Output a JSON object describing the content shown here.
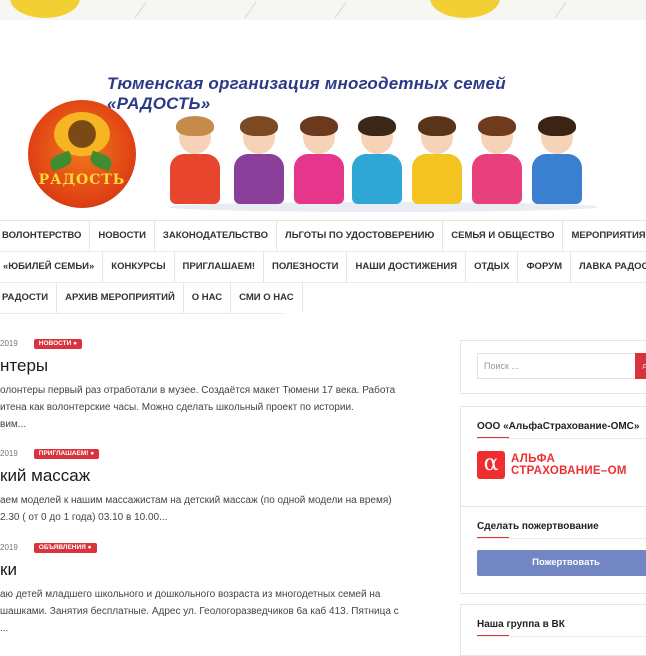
{
  "site": {
    "title": "Тюменская организация многодетных семей «РАДОСТЬ»",
    "logo_text": "РАДОСТЬ"
  },
  "nav": {
    "rows": [
      [
        "ВОЛОНТЕРСТВО",
        "НОВОСТИ",
        "ЗАКОНОДАТЕЛЬСТВО",
        "ЛЬГОТЫ ПО УДОСТОВЕРЕНИЮ",
        "СЕМЬЯ И ОБЩЕСТВО",
        "МЕРОПРИЯТИЯ"
      ],
      [
        "«ЮБИЛЕЙ СЕМЬИ»",
        "КОНКУРСЫ",
        "ПРИГЛАШАЕМ!",
        "ПОЛЕЗНОСТИ",
        "НАШИ ДОСТИЖЕНИЯ",
        "ОТДЫХ",
        "ФОРУМ",
        "ЛАВКА РАДОСТИ"
      ],
      [
        "РАДОСТИ",
        "АРХИВ МЕРОПРИЯТИЙ",
        "О НАС",
        "СМИ О НАС"
      ]
    ]
  },
  "posts": [
    {
      "date": "2019",
      "category": "НОВОСТИ",
      "title": "нтеры",
      "excerpt": [
        "олонтеры первый раз отработали в музее. Создаётся макет Тюмени 17 века. Работа",
        "итена как волонтерские часы. Можно сделать школьный проект по истории.",
        "вим..."
      ]
    },
    {
      "date": "2019",
      "category": "ПРИГЛАШАЕМ!",
      "title": "кий массаж",
      "excerpt": [
        "аем моделей к нашим массажистам на детский массаж (по одной модели на время)",
        "2.30 ( от 0 до 1 года) 03.10 в 10.00..."
      ]
    },
    {
      "date": "2019",
      "category": "ОБЪЯВЛЕНИЯ",
      "title": "ки",
      "excerpt": [
        "аю детей младшего школьного и дошкольного возраста из многодетных семей на",
        "шашками. Занятия бесплатные. Адрес ул. Геологоразведчиков 6а каб 413. Пятница с",
        "..."
      ]
    }
  ],
  "sidebar": {
    "search_placeholder": "Поиск ...",
    "sponsor_title": "ООО «АльфаСтрахование-ОМС»",
    "sponsor_logo_line1": "АЛЬФА",
    "sponsor_logo_line2": "СТРАХОВАНИЕ–ОМ",
    "sponsor_logo_mark": "α",
    "donate_title": "Сделать пожертвование",
    "donate_button": "Пожертвовать",
    "vk_title": "Наша группа в ВК"
  },
  "colors": {
    "accent": "#d9343e",
    "title_blue": "#2b3a86",
    "donate_button": "#7286c3",
    "sponsor_red": "#ef2e31"
  }
}
